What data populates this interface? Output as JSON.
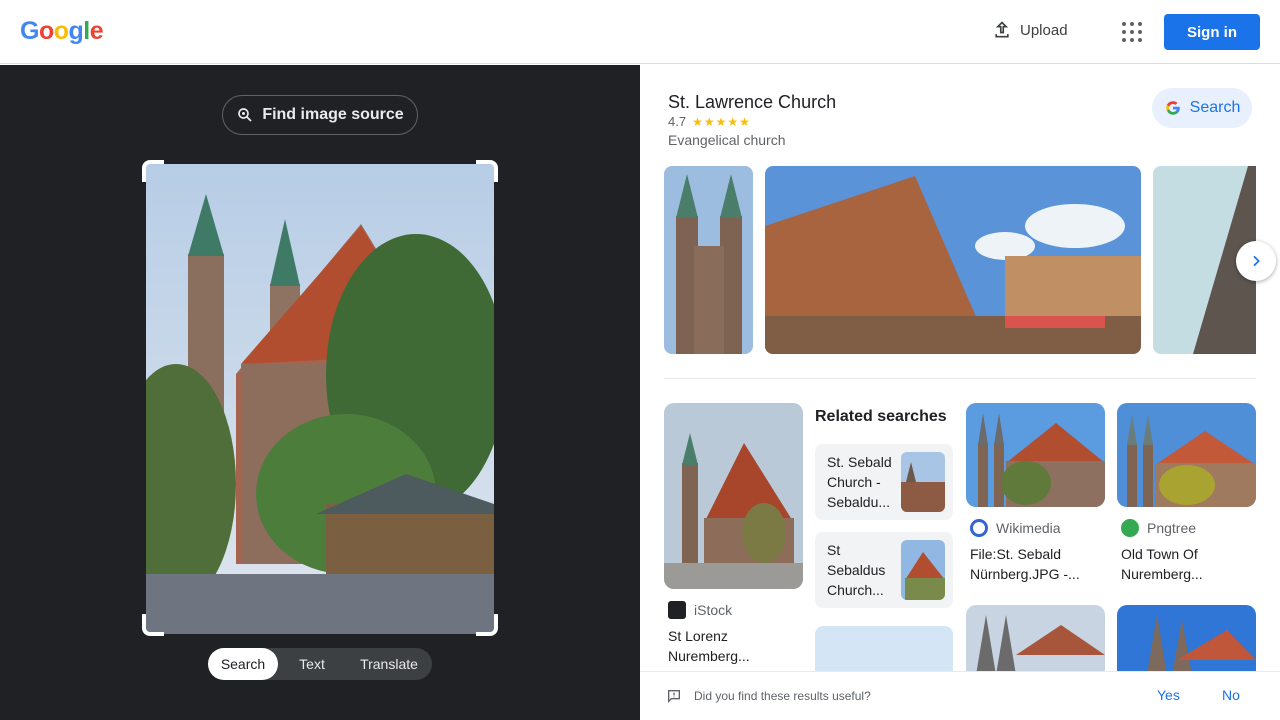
{
  "header": {
    "logo": [
      "G",
      "o",
      "o",
      "g",
      "l",
      "e"
    ],
    "logo_colors": [
      "#4285f4",
      "#ea4335",
      "#fbbc04",
      "#4285f4",
      "#34a853",
      "#ea4335"
    ],
    "upload_label": "Upload",
    "signin_label": "Sign in"
  },
  "lens": {
    "find_source_label": "Find image source",
    "modes": [
      "Search",
      "Text",
      "Translate"
    ],
    "active_mode": "Search"
  },
  "knowledge": {
    "title": "St. Lawrence Church",
    "rating": "4.7",
    "stars": "★★★★★",
    "subtitle": "Evangelical church",
    "search_label": "Search"
  },
  "results": [
    {
      "source": "iStock",
      "title": "St Lorenz Nuremberg...",
      "icon_color": "#202124"
    },
    {
      "source": "Wikimedia",
      "title": "File:St. Sebald Nürnberg.JPG -...",
      "icon_color": "#3366cc"
    },
    {
      "source": "Pngtree",
      "title": "Old Town Of Nuremberg...",
      "icon_color": "#34a853"
    }
  ],
  "related": {
    "heading": "Related searches",
    "items": [
      "St. Sebald Church - Sebaldu...",
      "St Sebaldus Church..."
    ]
  },
  "feedback": {
    "question": "Did you find these results useful?",
    "yes": "Yes",
    "no": "No"
  },
  "colors": {
    "accent": "#1a73e8",
    "dark_panel": "#202124",
    "star": "#fbbc04"
  }
}
